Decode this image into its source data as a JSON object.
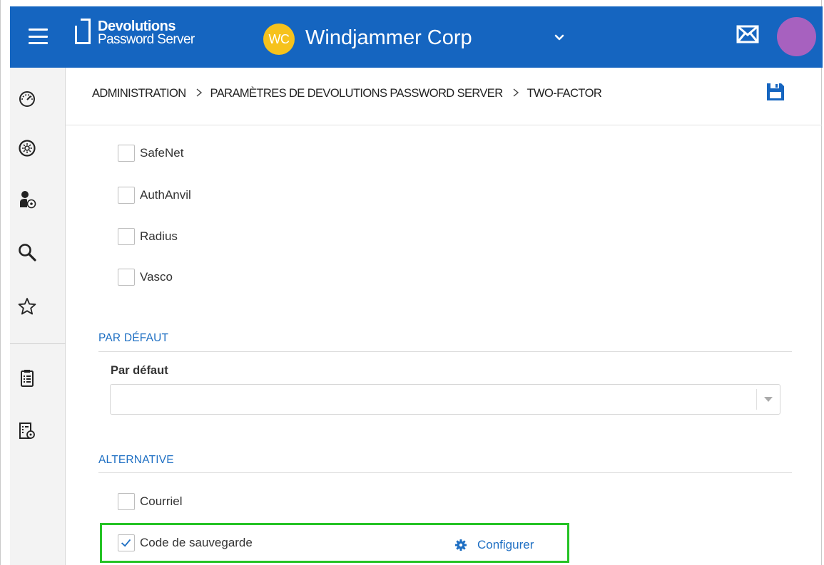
{
  "header": {
    "brand_line1": "Devolutions",
    "brand_line2": "Password Server",
    "org_initials": "WC",
    "org_name": "Windjammer Corp",
    "colors": {
      "bar": "#1565c0",
      "org_badge": "#f6c21c",
      "avatar": "#a761bf"
    },
    "icons": [
      "menu-icon",
      "chevron-down-icon",
      "mail-icon"
    ]
  },
  "sidebar": {
    "items": [
      {
        "icon": "dashboard-icon"
      },
      {
        "icon": "settings-circle-icon"
      },
      {
        "icon": "user-admin-icon"
      },
      {
        "icon": "search-icon"
      },
      {
        "icon": "star-icon"
      },
      {
        "icon": "clipboard-icon"
      },
      {
        "icon": "report-settings-icon"
      }
    ]
  },
  "breadcrumb": {
    "items": [
      "ADMINISTRATION",
      "PARAMÈTRES DE DEVOLUTIONS PASSWORD SERVER",
      "TWO-FACTOR"
    ],
    "save_icon": "save-icon"
  },
  "options": [
    {
      "label": "SafeNet",
      "checked": false
    },
    {
      "label": "AuthAnvil",
      "checked": false
    },
    {
      "label": "Radius",
      "checked": false
    },
    {
      "label": "Vasco",
      "checked": false
    }
  ],
  "default_section": {
    "title": "PAR DÉFAUT",
    "field_label": "Par défaut",
    "value": ""
  },
  "alternative_section": {
    "title": "ALTERNATIVE",
    "items": [
      {
        "label": "Courriel",
        "checked": false
      },
      {
        "label": "Code de sauvegarde",
        "checked": true
      }
    ],
    "configure_label": "Configurer",
    "highlight_color": "#25c325"
  }
}
